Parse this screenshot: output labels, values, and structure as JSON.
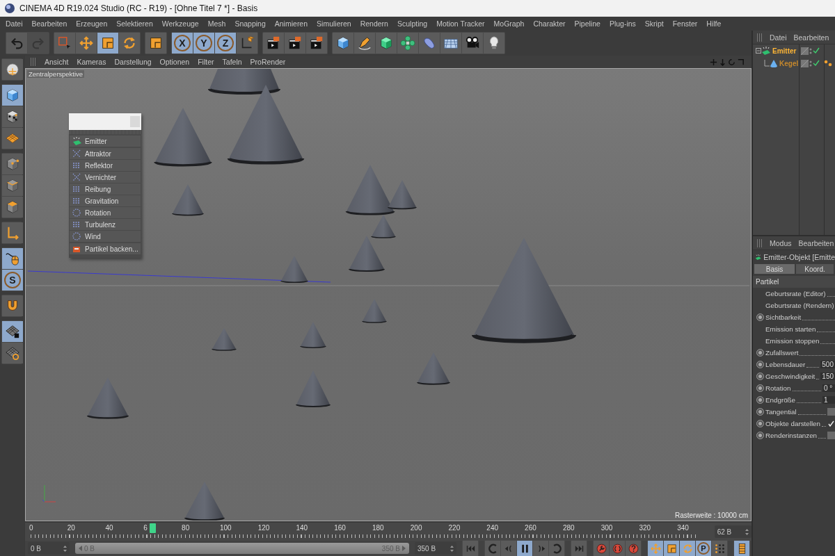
{
  "window": {
    "title": "CINEMA 4D R19.024 Studio (RC - R19) - [Ohne Titel 7 *] - Basis"
  },
  "menu": [
    "Datei",
    "Bearbeiten",
    "Erzeugen",
    "Selektieren",
    "Werkzeuge",
    "Mesh",
    "Snapping",
    "Animieren",
    "Simulieren",
    "Rendern",
    "Sculpting",
    "Motion Tracker",
    "MoGraph",
    "Charakter",
    "Pipeline",
    "Plug-ins",
    "Skript",
    "Fenster",
    "Hilfe"
  ],
  "toolbar": [
    [
      {
        "kind": "undo",
        "selected": false,
        "disabled": false
      },
      {
        "kind": "redo",
        "selected": false,
        "disabled": true
      }
    ],
    [
      {
        "kind": "select",
        "selected": false,
        "disabled": false
      },
      {
        "kind": "move",
        "selected": false,
        "disabled": false
      },
      {
        "kind": "scale",
        "selected": true,
        "disabled": false
      },
      {
        "kind": "rotate",
        "selected": false,
        "disabled": false
      }
    ],
    [
      {
        "kind": "square",
        "selected": false,
        "disabled": false
      }
    ],
    [
      {
        "kind": "letter",
        "label": "X",
        "selected": true,
        "disabled": false
      },
      {
        "kind": "letter",
        "label": "Y",
        "selected": true,
        "disabled": false
      },
      {
        "kind": "letter",
        "label": "Z",
        "selected": true,
        "disabled": false
      },
      {
        "kind": "coords",
        "selected": false,
        "disabled": false
      }
    ],
    [
      {
        "kind": "render",
        "selected": false,
        "disabled": false
      },
      {
        "kind": "render",
        "selected": false,
        "disabled": false
      },
      {
        "kind": "render",
        "selected": false,
        "disabled": false
      }
    ],
    [
      {
        "kind": "cube",
        "selected": false,
        "disabled": false
      },
      {
        "kind": "pen",
        "selected": false,
        "disabled": false
      },
      {
        "kind": "greencube",
        "selected": false,
        "disabled": false
      },
      {
        "kind": "flower",
        "selected": false,
        "disabled": false
      },
      {
        "kind": "deformer",
        "selected": false,
        "disabled": false
      },
      {
        "kind": "floor",
        "selected": false,
        "disabled": false
      },
      {
        "kind": "camera",
        "selected": false,
        "disabled": false
      },
      {
        "kind": "light",
        "selected": false,
        "disabled": false
      }
    ]
  ],
  "left_toolbar": [
    [
      {
        "kind": "sphere",
        "selected": false
      }
    ],
    [
      {
        "kind": "cube",
        "selected": true
      },
      {
        "kind": "checker",
        "selected": false
      },
      {
        "kind": "plane",
        "selected": false
      }
    ],
    [
      {
        "kind": "points",
        "selected": false
      },
      {
        "kind": "edges",
        "selected": false
      },
      {
        "kind": "faces",
        "selected": false
      }
    ],
    [
      {
        "kind": "axis",
        "selected": false
      }
    ],
    [
      {
        "kind": "mouse",
        "selected": true
      },
      {
        "kind": "letter",
        "label": "S",
        "selected": true
      }
    ],
    [
      {
        "kind": "magnet",
        "selected": false
      }
    ],
    [
      {
        "kind": "gridlock",
        "selected": true
      },
      {
        "kind": "gridcycle",
        "selected": false
      }
    ]
  ],
  "viewport": {
    "menu": [
      "Ansicht",
      "Kameras",
      "Darstellung",
      "Optionen",
      "Filter",
      "Tafeln",
      "ProRender"
    ],
    "camera": "Zentralperspektive",
    "grid_info": "Rasterweite : 10000 cm",
    "popup": {
      "groups": [
        [
          {
            "kind": "emitter",
            "label": "Emitter"
          }
        ],
        [
          {
            "kind": "attractor",
            "label": "Attraktor"
          },
          {
            "kind": "reflector",
            "label": "Reflektor"
          },
          {
            "kind": "destructor",
            "label": "Vernichter"
          },
          {
            "kind": "friction",
            "label": "Reibung"
          },
          {
            "kind": "gravity",
            "label": "Gravitation"
          },
          {
            "kind": "rotation",
            "label": "Rotation"
          },
          {
            "kind": "turbulence",
            "label": "Turbulenz"
          },
          {
            "kind": "wind",
            "label": "Wind"
          }
        ],
        [
          {
            "kind": "bake",
            "label": "Partikel backen..."
          }
        ]
      ]
    }
  },
  "timeline": {
    "ruler": [
      "0",
      "20",
      "40",
      "6",
      "80",
      "100",
      "120",
      "140",
      "160",
      "180",
      "200",
      "220",
      "240",
      "260",
      "280",
      "300",
      "320",
      "340"
    ],
    "playhead": {
      "level": 0.177
    },
    "current": "62 B",
    "start": "0 B",
    "range": {
      "level": 1
    },
    "range_start": "0 B",
    "range_end": "350 B",
    "end": "350 B"
  },
  "transport": [
    [
      {
        "kind": "first",
        "selected": false
      }
    ],
    [
      {
        "kind": "loopback",
        "selected": false
      },
      {
        "kind": "prev",
        "selected": false
      },
      {
        "kind": "pause",
        "selected": true
      },
      {
        "kind": "next",
        "selected": false
      },
      {
        "kind": "loopfwd",
        "selected": false
      }
    ],
    [
      {
        "kind": "last",
        "selected": false
      }
    ],
    [
      {
        "kind": "rec1",
        "selected": false
      },
      {
        "kind": "rec2",
        "selected": false
      },
      {
        "kind": "rec3",
        "selected": false
      }
    ],
    [
      {
        "kind": "move",
        "selected": true
      },
      {
        "kind": "scale",
        "selected": true
      },
      {
        "kind": "rotate",
        "selected": true
      },
      {
        "kind": "letter",
        "label": "P",
        "selected": true
      },
      {
        "kind": "dots",
        "selected": false
      }
    ],
    [
      {
        "kind": "film",
        "selected": true
      }
    ]
  ],
  "object_manager": {
    "menu": [
      "Datei",
      "Bearbeiten"
    ],
    "objects": [
      {
        "name": "Emitter",
        "kind": "emitter",
        "selected": true,
        "children": [
          {
            "name": "Kegel",
            "kind": "cone",
            "selected": false
          }
        ]
      }
    ]
  },
  "attributes": {
    "menu": [
      "Modus",
      "Bearbeiten"
    ],
    "title": "Emitter-Objekt [Emitte",
    "tabs": [
      {
        "label": "Basis",
        "selected": true
      },
      {
        "label": "Koord.",
        "selected": false
      }
    ],
    "section": "Partikel",
    "properties": [
      {
        "label": "Geburtsrate (Editor)",
        "animatable": false,
        "kind": "plain"
      },
      {
        "label": "Geburtsrate (Rendern)",
        "animatable": false,
        "kind": "plain"
      },
      {
        "label": "Sichtbarkeit",
        "animatable": true,
        "kind": "plain"
      },
      {
        "label": "Emission starten",
        "animatable": false,
        "kind": "plain"
      },
      {
        "label": "Emission stoppen",
        "animatable": false,
        "kind": "plain"
      },
      {
        "label": "Zufallswert",
        "animatable": true,
        "kind": "plain"
      },
      {
        "label": "Lebensdauer",
        "animatable": true,
        "kind": "number",
        "value": "500"
      },
      {
        "label": "Geschwindigkeit",
        "animatable": true,
        "kind": "number",
        "value": "150"
      },
      {
        "label": "Rotation",
        "animatable": true,
        "kind": "number",
        "value": "0 °"
      },
      {
        "label": "Endgröße",
        "animatable": true,
        "kind": "number",
        "value": "1"
      },
      {
        "label": "Tangential",
        "animatable": true,
        "kind": "checkbox",
        "checked": false
      },
      {
        "label": "Objekte darstellen",
        "animatable": true,
        "kind": "checkbox",
        "checked": true
      },
      {
        "label": "Renderinstanzen",
        "animatable": true,
        "kind": "checkbox",
        "checked": false
      }
    ]
  }
}
